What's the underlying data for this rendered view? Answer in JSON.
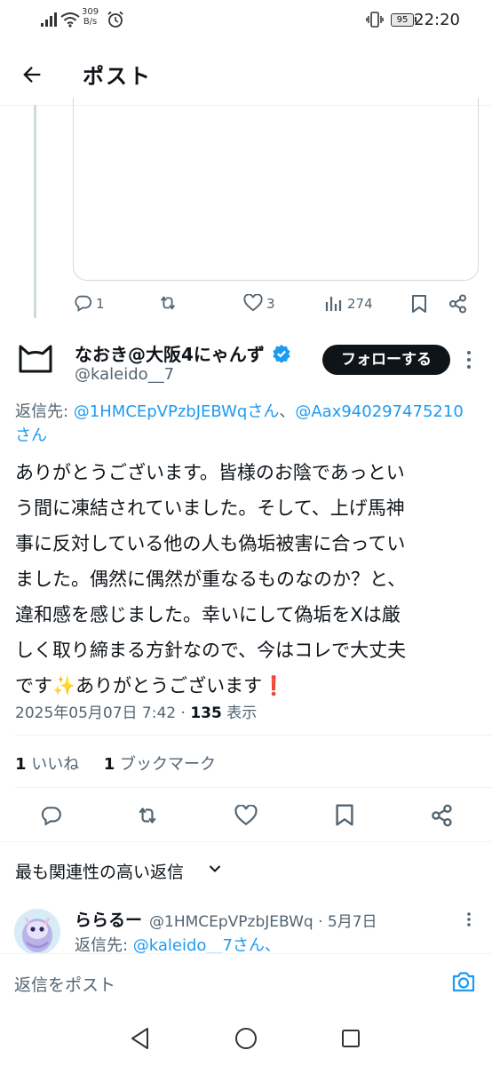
{
  "status_bar": {
    "net_speed_value": "309",
    "net_speed_unit": "B/s",
    "battery": "95",
    "time": "22:20"
  },
  "header": {
    "back_icon": "arrow-left-icon",
    "title": "ポスト"
  },
  "previous_post_actions": {
    "replies": "1",
    "likes": "3",
    "views": "274"
  },
  "post": {
    "display_name": "なおき@大阪4にゃんず",
    "verified_icon": "verified-badge-icon",
    "handle": "@kaleido__7",
    "follow_label": "フォローする",
    "reply_to_label": "返信先: ",
    "reply_to_mention_1": "@1HMCEpVPzbJEBWqさん",
    "reply_to_separator": "、",
    "reply_to_mention_2": "@Aax940297475210",
    "reply_to_mention_2_tail": "さん",
    "text_line_1": "ありがとうございます。皆様のお陰であっとい",
    "text_line_2": "う間に凍結されていました。そして、上げ馬神",
    "text_line_3": "事に反対している他の人も偽垢被害に合ってい",
    "text_line_4": "ました。偶然に偶然が重なるものなのか？と、",
    "text_line_5": "違和感を感じました。幸いにして偽垢をXは厳",
    "text_line_6": "しく取り締まる方針なので、今はコレで大丈夫",
    "text_line_7a": "です",
    "text_emoji_1": "✨",
    "text_line_7b": "ありがとうございます",
    "text_emoji_2": "❗",
    "timestamp": "2025年05月07日 7:42",
    "timestamp_sep": " · ",
    "views_count": "135",
    "views_label": " 表示",
    "likes_count": "1",
    "likes_label": " いいね",
    "bookmarks_count": "1",
    "bookmarks_label": " ブックマーク"
  },
  "replies_section": {
    "sort_label": "最も関連性の高い返信",
    "first_reply": {
      "name": "ららるー",
      "handle": "@1HMCEpVPzbJEBWq",
      "sep": " · ",
      "date": "5月7日",
      "reply_to_label": "返信先: ",
      "reply_to_mention": "@kaleido__7さん、"
    }
  },
  "composer": {
    "placeholder": "返信をポスト",
    "camera_icon": "camera-icon"
  },
  "colors": {
    "accent": "#1d9bf0",
    "text": "#0f1419",
    "secondary": "#536471",
    "divider": "#eff3f4"
  }
}
